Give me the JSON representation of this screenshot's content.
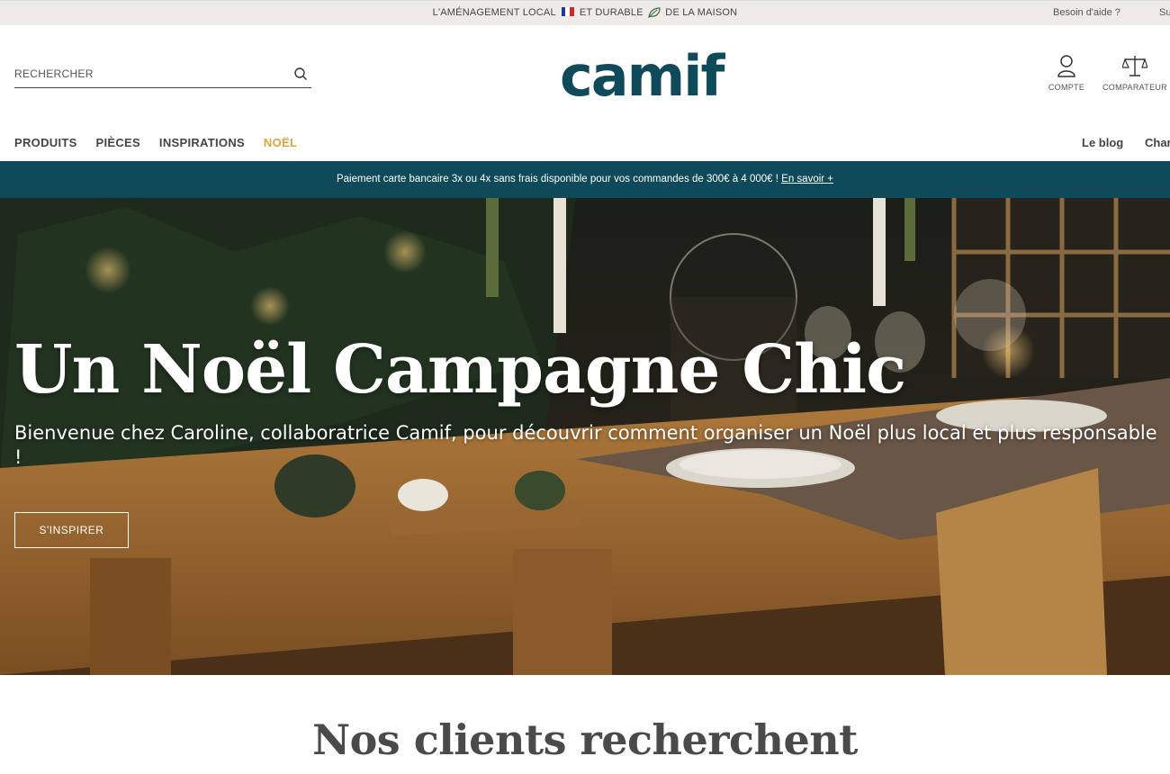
{
  "topbar": {
    "tagline_part1": "L'AMÉNAGEMENT LOCAL",
    "tagline_part2": "ET DURABLE",
    "tagline_part3": "DE LA MAISON",
    "help": "Besoin d'aide ?",
    "secondary_truncated": "Su"
  },
  "header": {
    "search_placeholder": "RECHERCHER",
    "logo_text": "camif",
    "account_label": "COMPTE",
    "compare_label": "COMPARATEUR"
  },
  "nav": {
    "items": [
      "PRODUITS",
      "PIÈCES",
      "INSPIRATIONS",
      "NOËL"
    ],
    "right_blog": "Le blog",
    "right_truncated": "Char"
  },
  "promo": {
    "text": "Paiement carte bancaire 3x ou 4x sans frais disponible pour vos commandes de 300€ à 4 000€ !",
    "link": "En savoir +"
  },
  "hero": {
    "title": "Un Noël Campagne Chic",
    "subtitle": "Bienvenue chez Caroline, collaboratrice Camif, pour découvrir comment organiser un Noël plus local et plus responsable !",
    "cta": "S'INSPIRER"
  },
  "section": {
    "title": "Nos clients recherchent"
  },
  "colors": {
    "brand": "#0f4a5a",
    "noel_accent": "#d9a441",
    "topbar_bg": "#efece7"
  }
}
